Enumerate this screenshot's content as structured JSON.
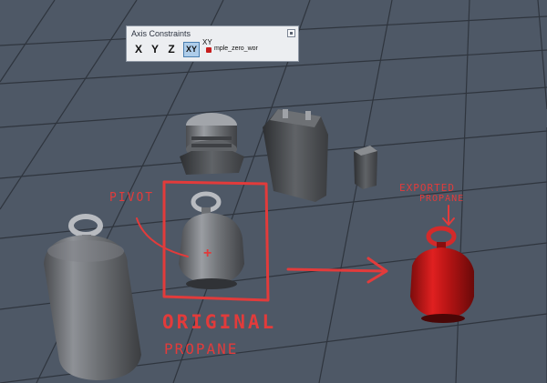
{
  "toolbar": {
    "title": "Axis Constraints",
    "buttons": [
      {
        "label": "X",
        "active": false
      },
      {
        "label": "Y",
        "active": false
      },
      {
        "label": "Z",
        "active": false
      },
      {
        "label": "XY",
        "active": true
      }
    ],
    "xy_flyout_label": "XY",
    "snap_text": "mple_zero_wor",
    "close_icon": "close-icon"
  },
  "annotations": {
    "pivot": "PIVOT",
    "exported_line1": "EXPORTED",
    "exported_line2": "PROPANE",
    "original_line1": "ORIGINAL",
    "original_line2": "PROPANE",
    "pivot_marker": "+"
  },
  "colors": {
    "viewport_bg": "#4e5866",
    "grid": "#2f353e",
    "annotation": "#e23b3b",
    "exported_object": "#c41515",
    "object_gray": "#8a8d91"
  }
}
